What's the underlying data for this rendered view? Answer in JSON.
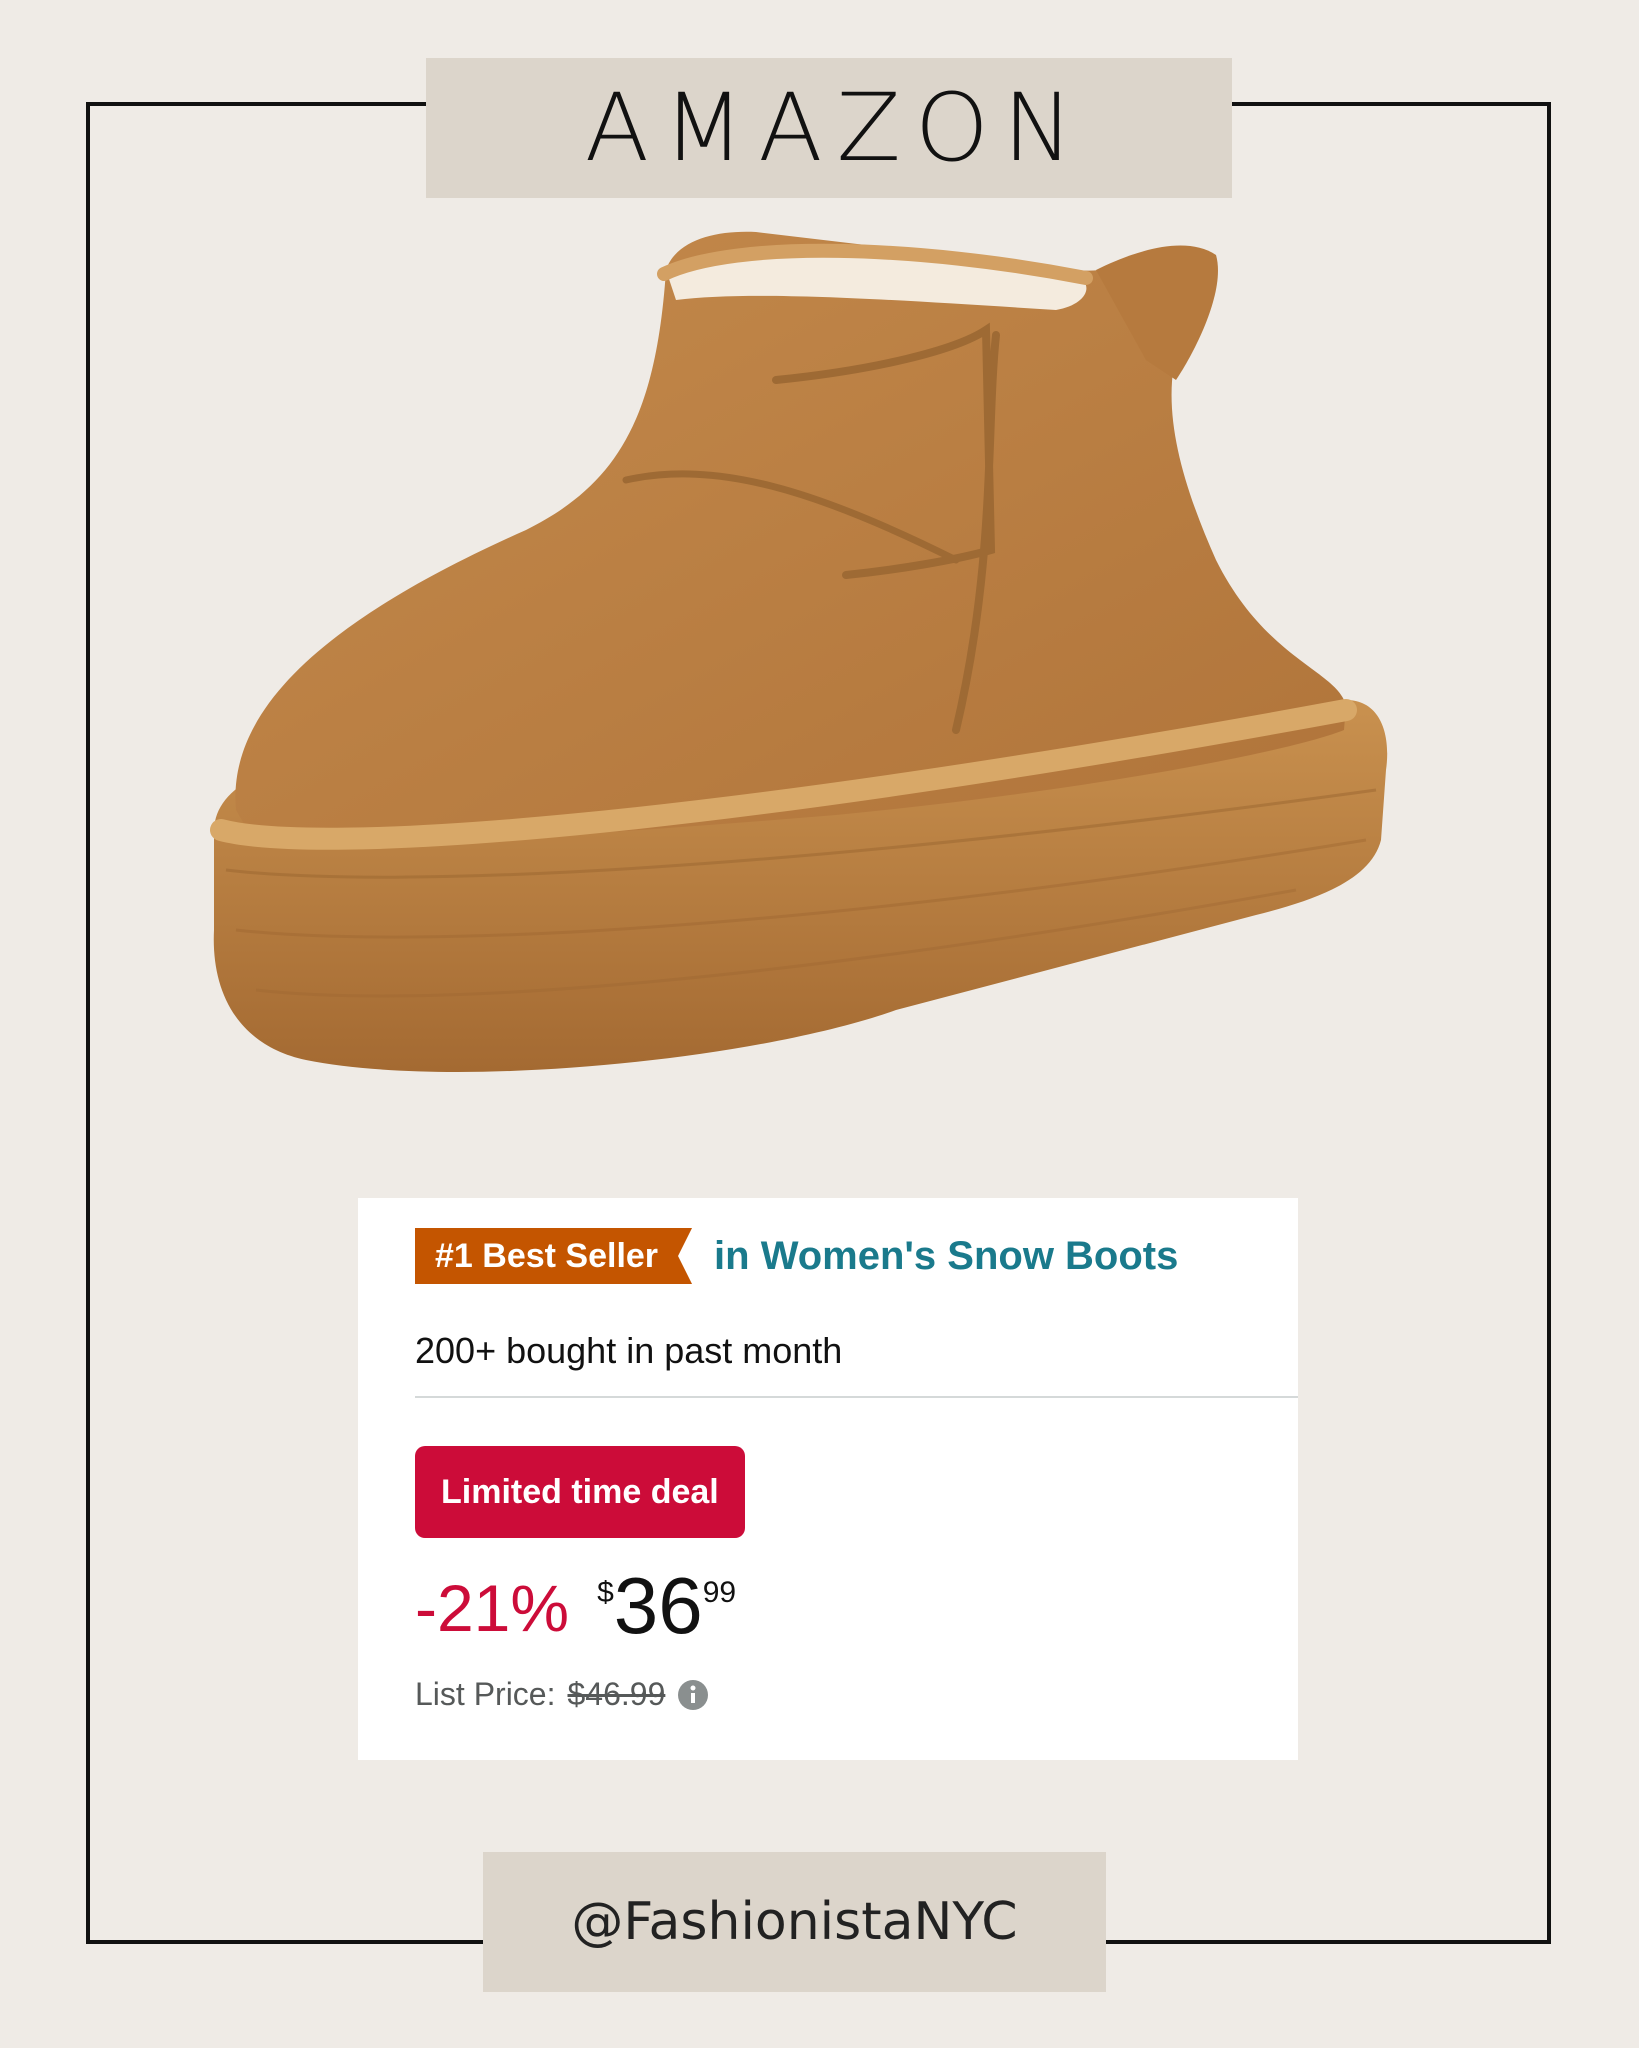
{
  "header": {
    "title": "AMAZON"
  },
  "footer": {
    "handle": "@FashionistaNYC"
  },
  "product": {
    "best_seller_badge": "#1 Best Seller",
    "category": "in Women's Snow Boots",
    "bought": "200+ bought in past month",
    "deal_badge": "Limited time deal",
    "discount": "-21%",
    "currency": "$",
    "price_whole": "36",
    "price_fraction": "99",
    "list_price_label": "List Price:",
    "list_price": "$46.99"
  },
  "colors": {
    "background": "#efebe6",
    "label_bg": "#dcd5cb",
    "best_seller": "#c45500",
    "category_link": "#1a7a8c",
    "deal": "#cc0c39",
    "boot": "#c08448"
  },
  "icons": {
    "info": "info-icon"
  }
}
